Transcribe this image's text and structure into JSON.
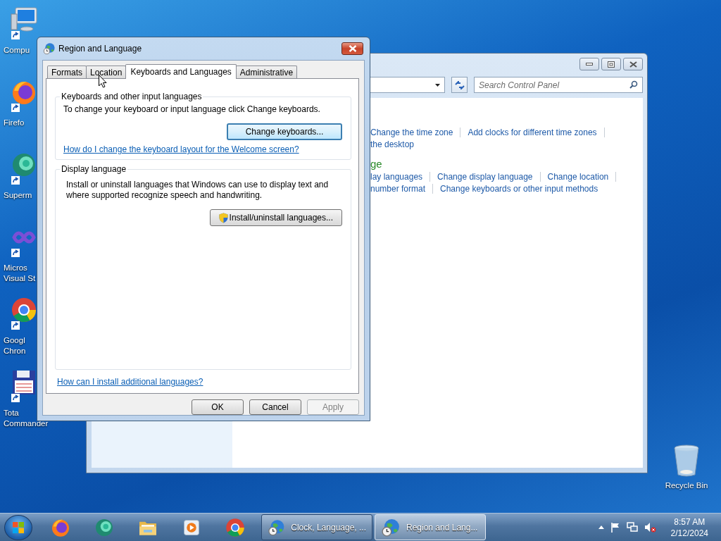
{
  "desktop_icons": [
    {
      "kind": "computer",
      "lines": [
        "Compu"
      ]
    },
    {
      "kind": "firefox",
      "lines": [
        "Firefo"
      ]
    },
    {
      "kind": "supermium",
      "lines": [
        "Superm"
      ]
    },
    {
      "kind": "visual-studio",
      "lines": [
        "Micros",
        "Visual St"
      ]
    },
    {
      "kind": "chrome",
      "lines": [
        "Googl",
        "Chron"
      ]
    },
    {
      "kind": "total-commander",
      "lines": [
        "Tota",
        "Commander"
      ]
    }
  ],
  "recycle_bin": {
    "label": "Recycle Bin"
  },
  "control_panel": {
    "search": {
      "placeholder": "Search Control Panel"
    },
    "sections": [
      {
        "links": [
          [
            "Change the time zone",
            "Add clocks for different time zones"
          ],
          [
            "the desktop"
          ]
        ]
      },
      {
        "heading": "ge",
        "links": [
          [
            "lay languages",
            "Change display language",
            "Change location"
          ],
          [
            "number format",
            "Change keyboards or other input methods"
          ]
        ]
      }
    ]
  },
  "dialog": {
    "title": "Region and Language",
    "tabs": [
      {
        "label": "Formats",
        "selected": false
      },
      {
        "label": "Location",
        "selected": false
      },
      {
        "label": "Keyboards and Languages",
        "selected": true
      },
      {
        "label": "Administrative",
        "selected": false
      }
    ],
    "groups": [
      {
        "title": "Keyboards and other input languages",
        "text": "To change your keyboard or input language click Change keyboards.",
        "button": {
          "label": "Change keyboards...",
          "focused": true,
          "shield": false
        },
        "link": "How do I change the keyboard layout for the Welcome screen?"
      },
      {
        "title": "Display language",
        "text": "Install or uninstall languages that Windows can use to display text and where supported recognize speech and handwriting.",
        "button": {
          "label": "Install/uninstall languages...",
          "focused": false,
          "shield": true
        }
      }
    ],
    "footer_link": "How can I install additional languages?",
    "buttons": [
      {
        "label": "OK",
        "disabled": false
      },
      {
        "label": "Cancel",
        "disabled": false
      },
      {
        "label": "Apply",
        "disabled": true
      }
    ]
  },
  "taskbar": {
    "pinned": [
      {
        "kind": "firefox"
      },
      {
        "kind": "supermium"
      },
      {
        "kind": "explorer"
      },
      {
        "kind": "media-player"
      },
      {
        "kind": "chrome"
      }
    ],
    "tasks": [
      {
        "label": "Clock, Language, ...",
        "selected": false
      },
      {
        "label": "Region and Lang...",
        "selected": true
      }
    ],
    "clock": {
      "time": "8:57 AM",
      "date": "2/12/2024"
    }
  }
}
